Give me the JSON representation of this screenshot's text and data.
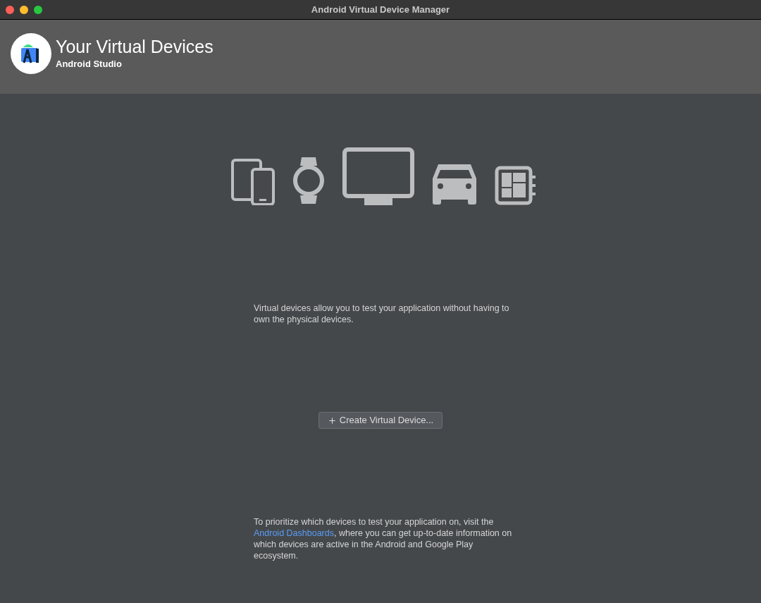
{
  "window": {
    "title": "Android Virtual Device Manager"
  },
  "header": {
    "title": "Your Virtual Devices",
    "subtitle": "Android Studio"
  },
  "description": "Virtual devices allow you to test your application without having to own the physical devices.",
  "create_button": {
    "label": "Create Virtual Device..."
  },
  "footer": {
    "before": "To prioritize which devices to test your application on, visit the ",
    "link": "Android Dashboards",
    "after": ", where you can get up-to-date information on which devices are active in the Android and Google Play ecosystem."
  }
}
